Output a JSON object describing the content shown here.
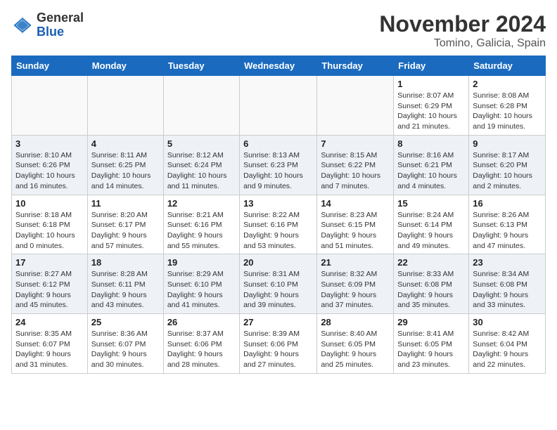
{
  "logo": {
    "general": "General",
    "blue": "Blue"
  },
  "title": "November 2024",
  "location": "Tomino, Galicia, Spain",
  "weekdays": [
    "Sunday",
    "Monday",
    "Tuesday",
    "Wednesday",
    "Thursday",
    "Friday",
    "Saturday"
  ],
  "weeks": [
    [
      {
        "day": "",
        "info": ""
      },
      {
        "day": "",
        "info": ""
      },
      {
        "day": "",
        "info": ""
      },
      {
        "day": "",
        "info": ""
      },
      {
        "day": "",
        "info": ""
      },
      {
        "day": "1",
        "info": "Sunrise: 8:07 AM\nSunset: 6:29 PM\nDaylight: 10 hours\nand 21 minutes."
      },
      {
        "day": "2",
        "info": "Sunrise: 8:08 AM\nSunset: 6:28 PM\nDaylight: 10 hours\nand 19 minutes."
      }
    ],
    [
      {
        "day": "3",
        "info": "Sunrise: 8:10 AM\nSunset: 6:26 PM\nDaylight: 10 hours\nand 16 minutes."
      },
      {
        "day": "4",
        "info": "Sunrise: 8:11 AM\nSunset: 6:25 PM\nDaylight: 10 hours\nand 14 minutes."
      },
      {
        "day": "5",
        "info": "Sunrise: 8:12 AM\nSunset: 6:24 PM\nDaylight: 10 hours\nand 11 minutes."
      },
      {
        "day": "6",
        "info": "Sunrise: 8:13 AM\nSunset: 6:23 PM\nDaylight: 10 hours\nand 9 minutes."
      },
      {
        "day": "7",
        "info": "Sunrise: 8:15 AM\nSunset: 6:22 PM\nDaylight: 10 hours\nand 7 minutes."
      },
      {
        "day": "8",
        "info": "Sunrise: 8:16 AM\nSunset: 6:21 PM\nDaylight: 10 hours\nand 4 minutes."
      },
      {
        "day": "9",
        "info": "Sunrise: 8:17 AM\nSunset: 6:20 PM\nDaylight: 10 hours\nand 2 minutes."
      }
    ],
    [
      {
        "day": "10",
        "info": "Sunrise: 8:18 AM\nSunset: 6:18 PM\nDaylight: 10 hours\nand 0 minutes."
      },
      {
        "day": "11",
        "info": "Sunrise: 8:20 AM\nSunset: 6:17 PM\nDaylight: 9 hours\nand 57 minutes."
      },
      {
        "day": "12",
        "info": "Sunrise: 8:21 AM\nSunset: 6:16 PM\nDaylight: 9 hours\nand 55 minutes."
      },
      {
        "day": "13",
        "info": "Sunrise: 8:22 AM\nSunset: 6:16 PM\nDaylight: 9 hours\nand 53 minutes."
      },
      {
        "day": "14",
        "info": "Sunrise: 8:23 AM\nSunset: 6:15 PM\nDaylight: 9 hours\nand 51 minutes."
      },
      {
        "day": "15",
        "info": "Sunrise: 8:24 AM\nSunset: 6:14 PM\nDaylight: 9 hours\nand 49 minutes."
      },
      {
        "day": "16",
        "info": "Sunrise: 8:26 AM\nSunset: 6:13 PM\nDaylight: 9 hours\nand 47 minutes."
      }
    ],
    [
      {
        "day": "17",
        "info": "Sunrise: 8:27 AM\nSunset: 6:12 PM\nDaylight: 9 hours\nand 45 minutes."
      },
      {
        "day": "18",
        "info": "Sunrise: 8:28 AM\nSunset: 6:11 PM\nDaylight: 9 hours\nand 43 minutes."
      },
      {
        "day": "19",
        "info": "Sunrise: 8:29 AM\nSunset: 6:10 PM\nDaylight: 9 hours\nand 41 minutes."
      },
      {
        "day": "20",
        "info": "Sunrise: 8:31 AM\nSunset: 6:10 PM\nDaylight: 9 hours\nand 39 minutes."
      },
      {
        "day": "21",
        "info": "Sunrise: 8:32 AM\nSunset: 6:09 PM\nDaylight: 9 hours\nand 37 minutes."
      },
      {
        "day": "22",
        "info": "Sunrise: 8:33 AM\nSunset: 6:08 PM\nDaylight: 9 hours\nand 35 minutes."
      },
      {
        "day": "23",
        "info": "Sunrise: 8:34 AM\nSunset: 6:08 PM\nDaylight: 9 hours\nand 33 minutes."
      }
    ],
    [
      {
        "day": "24",
        "info": "Sunrise: 8:35 AM\nSunset: 6:07 PM\nDaylight: 9 hours\nand 31 minutes."
      },
      {
        "day": "25",
        "info": "Sunrise: 8:36 AM\nSunset: 6:07 PM\nDaylight: 9 hours\nand 30 minutes."
      },
      {
        "day": "26",
        "info": "Sunrise: 8:37 AM\nSunset: 6:06 PM\nDaylight: 9 hours\nand 28 minutes."
      },
      {
        "day": "27",
        "info": "Sunrise: 8:39 AM\nSunset: 6:06 PM\nDaylight: 9 hours\nand 27 minutes."
      },
      {
        "day": "28",
        "info": "Sunrise: 8:40 AM\nSunset: 6:05 PM\nDaylight: 9 hours\nand 25 minutes."
      },
      {
        "day": "29",
        "info": "Sunrise: 8:41 AM\nSunset: 6:05 PM\nDaylight: 9 hours\nand 23 minutes."
      },
      {
        "day": "30",
        "info": "Sunrise: 8:42 AM\nSunset: 6:04 PM\nDaylight: 9 hours\nand 22 minutes."
      }
    ]
  ]
}
